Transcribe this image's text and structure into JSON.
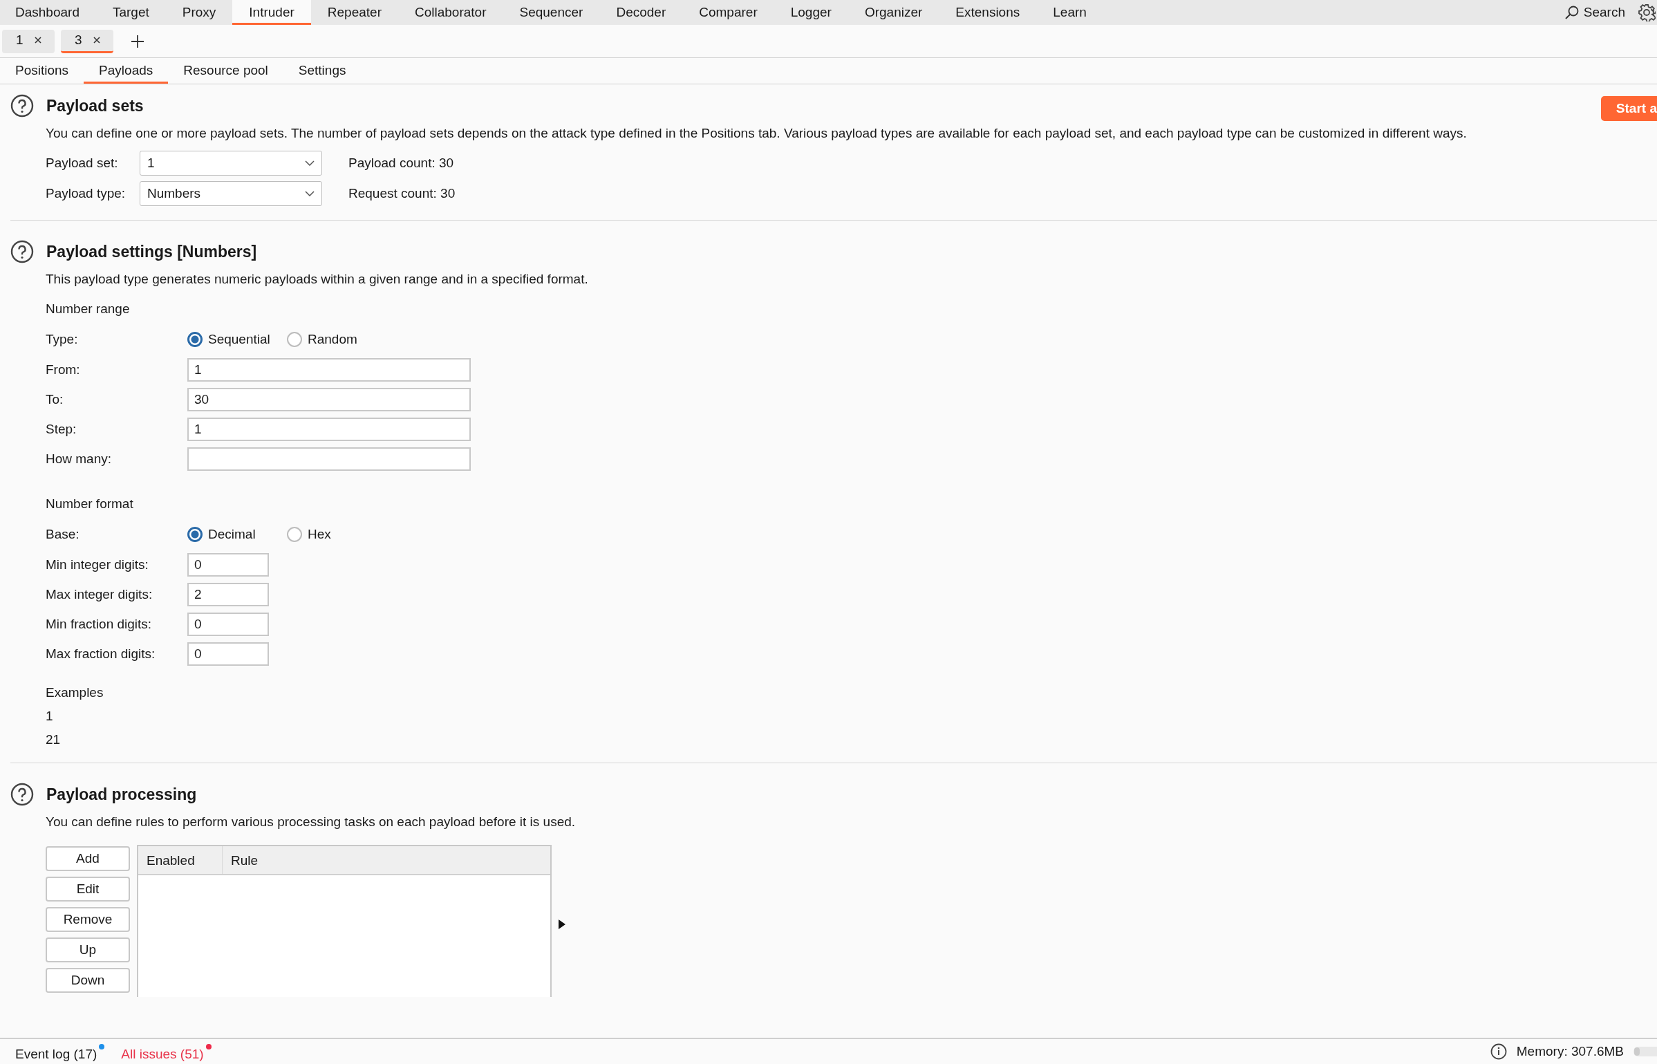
{
  "nav": {
    "items": [
      {
        "label": "Dashboard",
        "selected": false
      },
      {
        "label": "Target",
        "selected": false
      },
      {
        "label": "Proxy",
        "selected": false
      },
      {
        "label": "Intruder",
        "selected": true
      },
      {
        "label": "Repeater",
        "selected": false
      },
      {
        "label": "Collaborator",
        "selected": false
      },
      {
        "label": "Sequencer",
        "selected": false
      },
      {
        "label": "Decoder",
        "selected": false
      },
      {
        "label": "Comparer",
        "selected": false
      },
      {
        "label": "Logger",
        "selected": false
      },
      {
        "label": "Organizer",
        "selected": false
      },
      {
        "label": "Extensions",
        "selected": false
      },
      {
        "label": "Learn",
        "selected": false
      }
    ],
    "search": "Search"
  },
  "attack_tabs": [
    {
      "label": "1",
      "selected": false
    },
    {
      "label": "3",
      "selected": true
    }
  ],
  "sub_tabs": [
    {
      "label": "Positions",
      "selected": false
    },
    {
      "label": "Payloads",
      "selected": true
    },
    {
      "label": "Resource pool",
      "selected": false
    },
    {
      "label": "Settings",
      "selected": false
    }
  ],
  "payload_sets": {
    "title": "Payload sets",
    "start_button": "Start a",
    "description": "You can define one or more payload sets. The number of payload sets depends on the attack type defined in the Positions tab. Various payload types are available for each payload set, and each payload type can be customized in different ways.",
    "fields": [
      {
        "label": "Payload set:",
        "value": "1",
        "info": "Payload count: 30"
      },
      {
        "label": "Payload type:",
        "value": "Numbers",
        "info": "Request count: 30"
      }
    ]
  },
  "payload_settings": {
    "title": "Payload settings [Numbers]",
    "description": "This payload type generates numeric payloads within a given range and in a specified format.",
    "groups": [
      {
        "heading": "Number range",
        "radio_label": "Type:",
        "options": [
          {
            "label": "Sequential",
            "selected": true
          },
          {
            "label": "Random",
            "selected": false
          }
        ],
        "fields": [
          {
            "label": "From:",
            "value": "1"
          },
          {
            "label": "To:",
            "value": "30"
          },
          {
            "label": "Step:",
            "value": "1"
          },
          {
            "label": "How many:"
          }
        ]
      },
      {
        "heading": "Number format",
        "radio_label": "Base:",
        "options": [
          {
            "label": "Decimal",
            "selected": true
          },
          {
            "label": "Hex",
            "selected": false
          }
        ],
        "fields": [
          {
            "label": "Min integer digits:",
            "value": "0"
          },
          {
            "label": "Max integer digits:",
            "value": "2"
          },
          {
            "label": "Min fraction digits:",
            "value": "0"
          },
          {
            "label": "Max fraction digits:",
            "value": "0"
          }
        ]
      }
    ],
    "examples": {
      "heading": "Examples",
      "values": [
        "1",
        "21"
      ]
    }
  },
  "payload_processing": {
    "title": "Payload processing",
    "description": "You can define rules to perform various processing tasks on each payload before it is used.",
    "buttons": [
      "Add",
      "Edit",
      "Remove",
      "Up",
      "Down"
    ],
    "table": {
      "columns": [
        "Enabled",
        "Rule"
      ]
    }
  },
  "status_bar": {
    "items": [
      {
        "label": "Event log (17)",
        "kind": "normal",
        "color": "#1e90ea"
      },
      {
        "label": "All issues (51)",
        "kind": "alert",
        "color": "#ee2a4a"
      }
    ],
    "memory": "Memory: 307.6MB"
  }
}
